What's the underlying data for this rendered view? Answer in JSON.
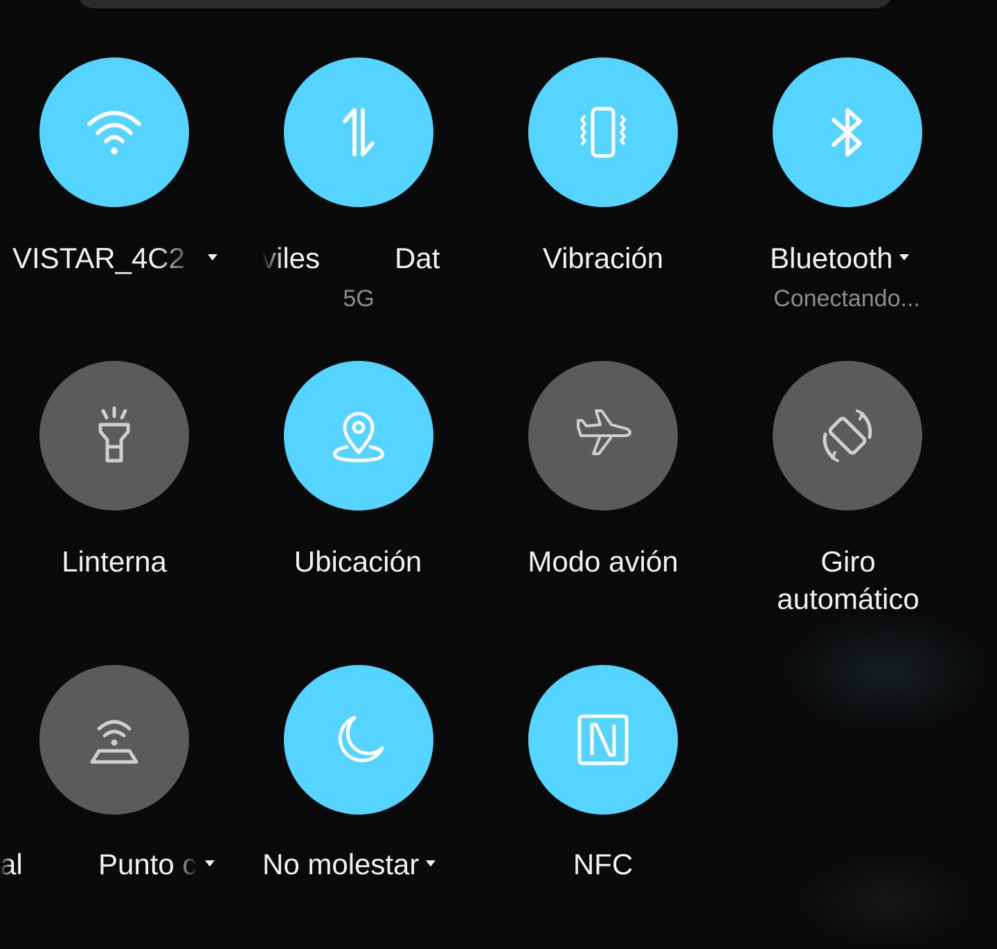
{
  "colors": {
    "active_tile": "#54d4ff",
    "inactive_tile": "#5b5b5b",
    "background": "#0a0a0a",
    "label_text": "#f2f2f2",
    "sublabel_text": "#8c8c8c"
  },
  "tiles": [
    {
      "id": "wifi",
      "icon": "wifi-icon",
      "active": true,
      "label": "VISTAR_4C2",
      "has_caret": true
    },
    {
      "id": "mobile-data",
      "icon": "data-arrows-icon",
      "active": true,
      "label_left": "viles",
      "label_right": "Dat",
      "sublabel": "5G"
    },
    {
      "id": "vibration",
      "icon": "vibration-icon",
      "active": true,
      "label": "Vibración"
    },
    {
      "id": "bluetooth",
      "icon": "bluetooth-icon",
      "active": true,
      "label": "Bluetooth",
      "has_caret": true,
      "sublabel": "Conectando..."
    },
    {
      "id": "flashlight",
      "icon": "flashlight-icon",
      "active": false,
      "label": "Linterna"
    },
    {
      "id": "location",
      "icon": "location-icon",
      "active": true,
      "label": "Ubicación"
    },
    {
      "id": "airplane",
      "icon": "airplane-icon",
      "active": false,
      "label": "Modo avión"
    },
    {
      "id": "auto-rotate",
      "icon": "rotate-icon",
      "active": false,
      "label_line1": "Giro",
      "label_line2": "automático"
    },
    {
      "id": "hotspot",
      "icon": "hotspot-icon",
      "active": false,
      "label_left": "al",
      "label_right": "Punto c",
      "has_caret": true
    },
    {
      "id": "do-not-disturb",
      "icon": "moon-icon",
      "active": true,
      "label": "No molestar",
      "has_caret": true
    },
    {
      "id": "nfc",
      "icon": "nfc-icon",
      "active": true,
      "label": "NFC"
    }
  ]
}
